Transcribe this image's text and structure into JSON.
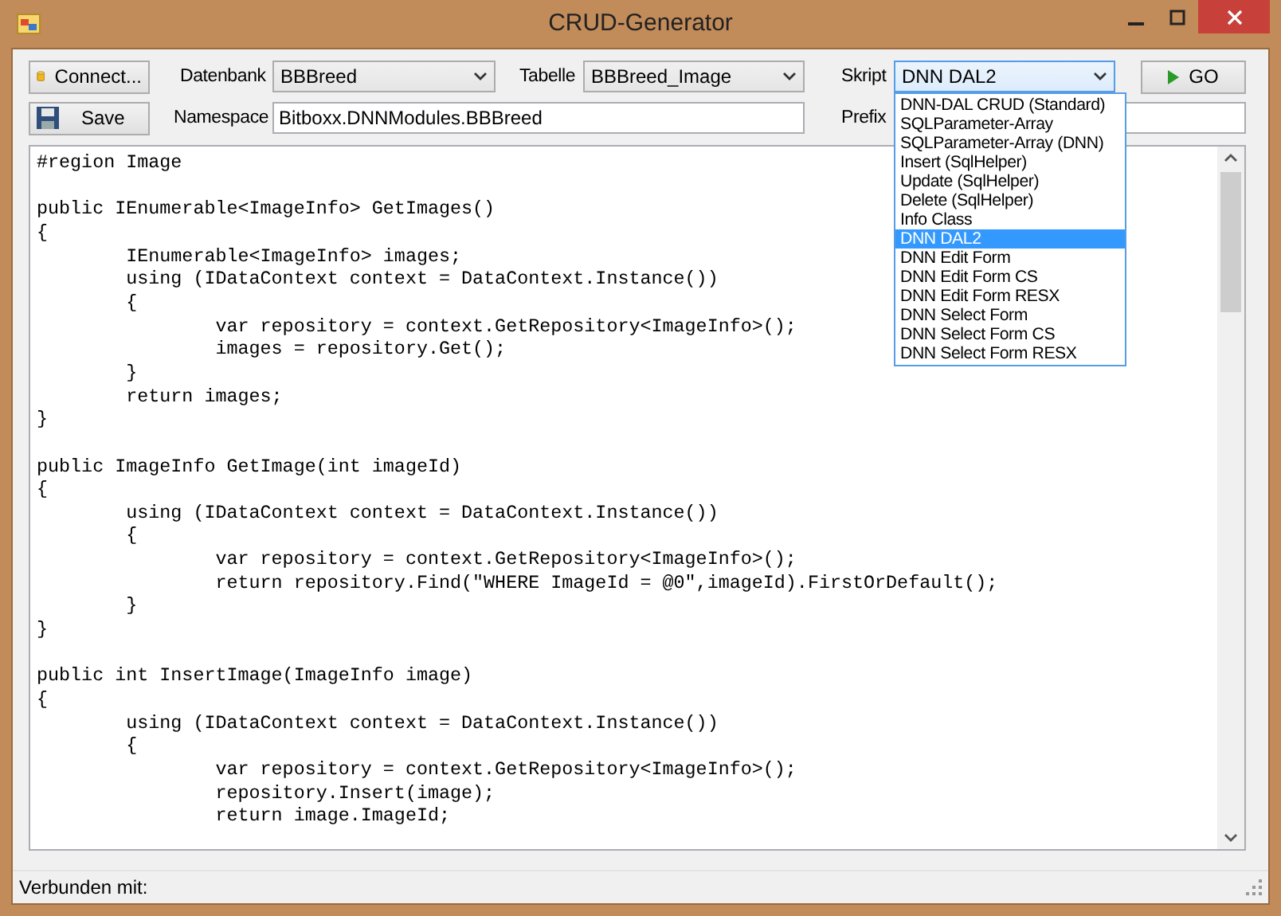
{
  "window": {
    "title": "CRUD-Generator"
  },
  "toolbar": {
    "connect_button": "Connect...",
    "save_button": "Save",
    "go_button": "GO",
    "datenbank": {
      "label": "Datenbank",
      "value": "BBBreed"
    },
    "tabelle": {
      "label": "Tabelle",
      "value": "BBBreed_Image"
    },
    "skript": {
      "label": "Skript",
      "value": "DNN DAL2",
      "expanded": true,
      "options": [
        {
          "label": "DNN-DAL CRUD (Standard)",
          "selected": false
        },
        {
          "label": "SQLParameter-Array",
          "selected": false
        },
        {
          "label": "SQLParameter-Array (DNN)",
          "selected": false
        },
        {
          "label": "Insert (SqlHelper)",
          "selected": false
        },
        {
          "label": "Update (SqlHelper)",
          "selected": false
        },
        {
          "label": "Delete (SqlHelper)",
          "selected": false
        },
        {
          "label": "Info Class",
          "selected": false
        },
        {
          "label": "DNN DAL2",
          "selected": true
        },
        {
          "label": "DNN Edit Form",
          "selected": false
        },
        {
          "label": "DNN Edit Form CS",
          "selected": false
        },
        {
          "label": "DNN Edit Form RESX",
          "selected": false
        },
        {
          "label": "DNN Select Form",
          "selected": false
        },
        {
          "label": "DNN Select Form CS",
          "selected": false
        },
        {
          "label": "DNN Select Form RESX",
          "selected": false
        }
      ]
    },
    "namespace": {
      "label": "Namespace",
      "value": "Bitboxx.DNNModules.BBBreed"
    },
    "prefix": {
      "label": "Prefix"
    }
  },
  "code_blocks": [
    [
      "#region Image"
    ],
    [
      "public IEnumerable<ImageInfo> GetImages()",
      "{",
      "\tIEnumerable<ImageInfo> images;",
      "\tusing (IDataContext context = DataContext.Instance())",
      "\t{",
      "\t\tvar repository = context.GetRepository<ImageInfo>();",
      "\t\timages = repository.Get();",
      "\t}",
      "\treturn images;",
      "}"
    ],
    [
      "public ImageInfo GetImage(int imageId)",
      "{",
      "\tusing (IDataContext context = DataContext.Instance())",
      "\t{",
      "\t\tvar repository = context.GetRepository<ImageInfo>();",
      "\t\treturn repository.Find(\"WHERE ImageId = @0\",imageId).FirstOrDefault();",
      "\t}",
      "}"
    ],
    [
      "public int InsertImage(ImageInfo image)",
      "{",
      "\tusing (IDataContext context = DataContext.Instance())",
      "\t{",
      "\t\tvar repository = context.GetRepository<ImageInfo>();",
      "\t\trepository.Insert(image);",
      "\t\treturn image.ImageId;"
    ]
  ],
  "status_bar": {
    "text": "Verbunden mit:"
  }
}
